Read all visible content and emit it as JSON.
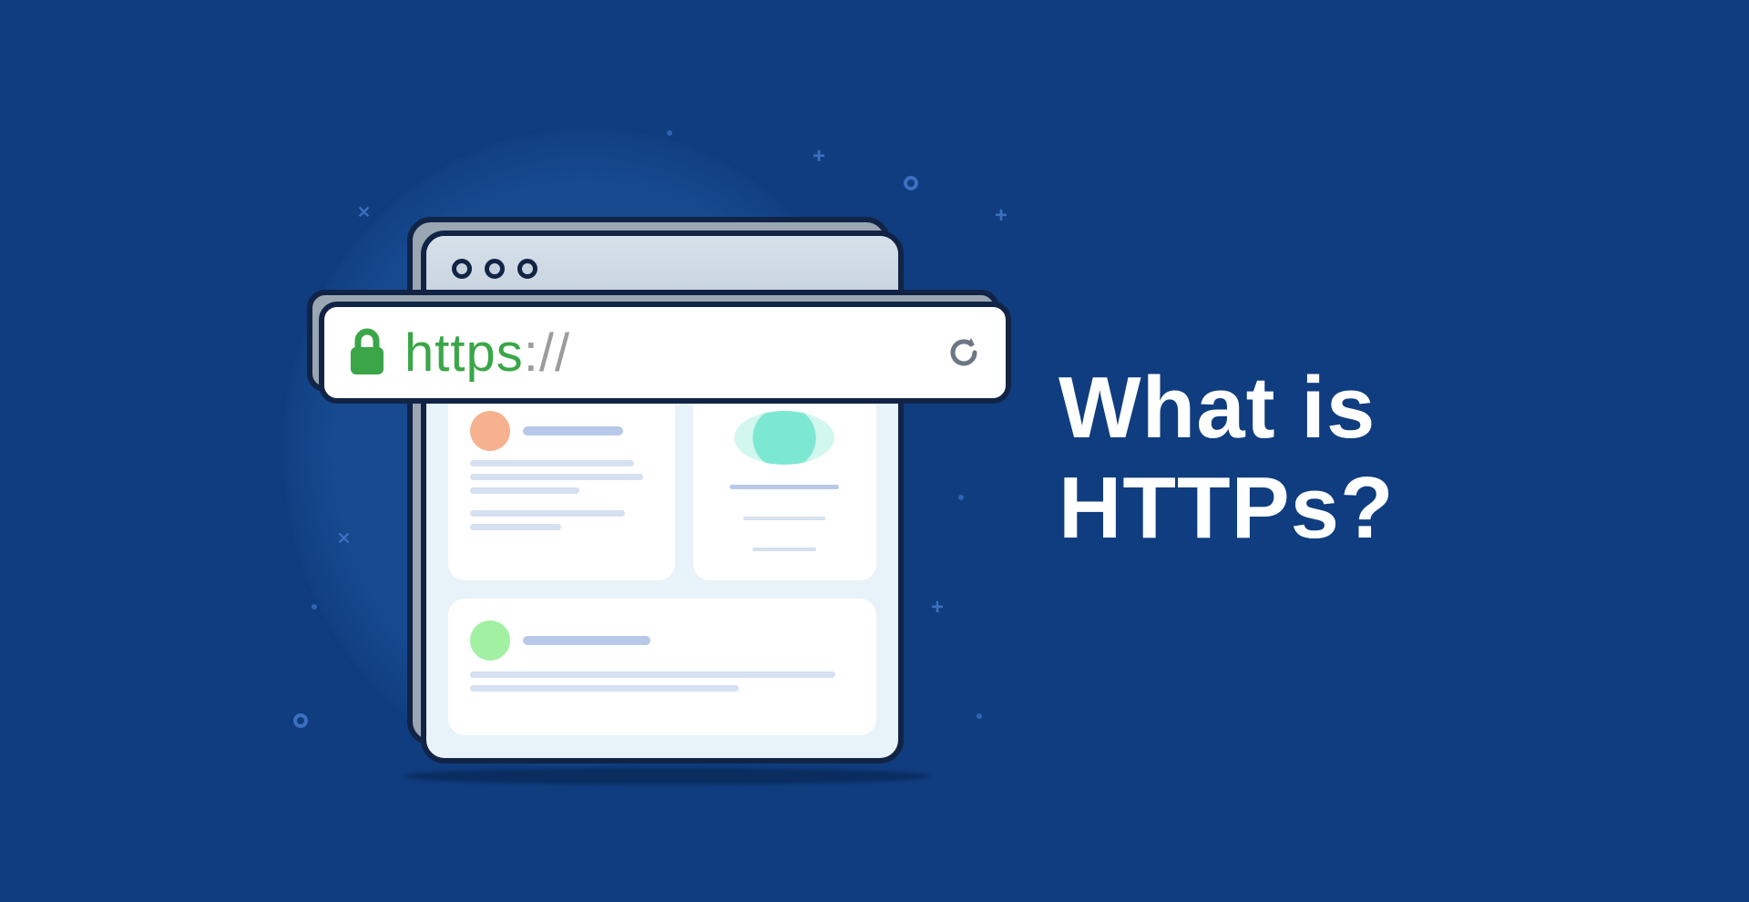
{
  "headline": {
    "line1": "What is",
    "line2": "HTTPs?"
  },
  "address_bar": {
    "protocol_https": "https",
    "protocol_separator": "://"
  },
  "icons": {
    "lock": "lock-icon",
    "reload": "reload-icon"
  },
  "colors": {
    "background": "#0f3d7f",
    "https_green": "#3aa648",
    "separator_grey": "#9c9c9c",
    "outline": "#122446"
  }
}
